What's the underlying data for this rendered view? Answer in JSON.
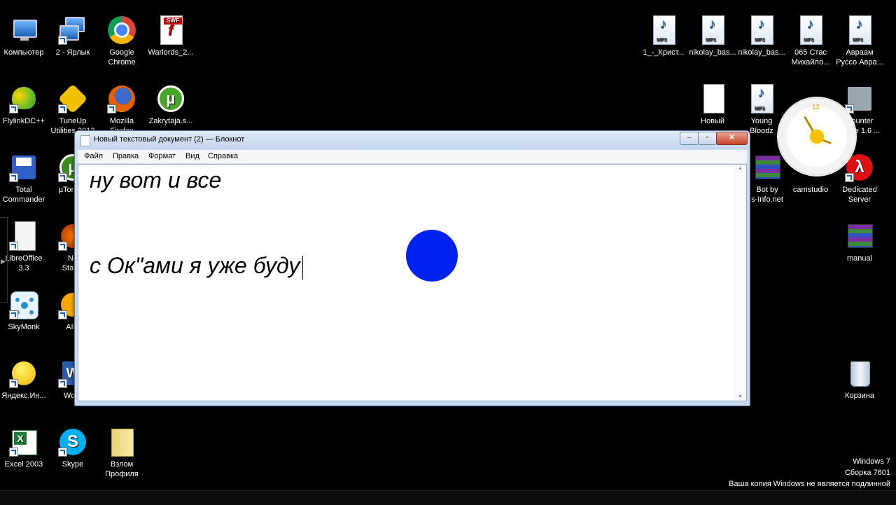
{
  "desktop": {
    "icons": [
      {
        "label": "Компьютер",
        "icon": "computer-icon"
      },
      {
        "label": "2 - Ярлык",
        "icon": "network-computer-icon"
      },
      {
        "label": "Google\nChrome",
        "icon": "chrome-icon"
      },
      {
        "label": "Warlords_2...",
        "icon": "swf-file-icon"
      },
      {
        "label": "FlylinkDC++",
        "icon": "flylink-icon"
      },
      {
        "label": "TuneUp\nUtilities 2013",
        "icon": "tuneup-icon"
      },
      {
        "label": "Mozilla\nFirefox",
        "icon": "firefox-icon"
      },
      {
        "label": "Zakrytaja.s...",
        "icon": "utorrent-icon"
      },
      {
        "label": "Total\nCommander",
        "icon": "total-commander-icon"
      },
      {
        "label": "µTorrent",
        "icon": "utorrent-icon"
      },
      {
        "label": "LibreOffice\n3.3",
        "icon": "libreoffice-icon"
      },
      {
        "label": "Ne\nStartS",
        "icon": "app-icon"
      },
      {
        "label": "SkyMonk",
        "icon": "skymonk-icon"
      },
      {
        "label": "AIM",
        "icon": "aim-icon"
      },
      {
        "label": "Яндекс.Ин...",
        "icon": "yandex-icon"
      },
      {
        "label": "Word",
        "icon": "word-icon"
      },
      {
        "label": "Excel 2003",
        "icon": "excel-icon"
      },
      {
        "label": "Skype",
        "icon": "skype-icon"
      },
      {
        "label": "Взлом\nПрофиля",
        "icon": "folder-icon"
      },
      {
        "label": "1_-_Крист...",
        "icon": "mp3-icon"
      },
      {
        "label": "nikolay_bas...",
        "icon": "mp3-icon"
      },
      {
        "label": "nikolay_bas...",
        "icon": "mp3-icon"
      },
      {
        "label": "065 Стас\nМихайло...",
        "icon": "mp3-icon"
      },
      {
        "label": "Авраам\nРуссо Авра...",
        "icon": "mp3-icon"
      },
      {
        "label": "Новый",
        "icon": "text-file-icon"
      },
      {
        "label": "Young\nBloodz",
        "icon": "mp3-icon"
      },
      {
        "label": "Counter\nStrike 1.6 ...",
        "icon": "counter-strike-icon"
      },
      {
        "label": "Bot by\ns-Info.net",
        "icon": "winrar-icon"
      },
      {
        "label": "camstudio",
        "icon": "camstudio-icon"
      },
      {
        "label": "Dedicated\nServer",
        "icon": "half-life-icon"
      },
      {
        "label": "manual",
        "icon": "winrar-icon"
      },
      {
        "label": "Корзина",
        "icon": "recycle-bin-icon"
      }
    ]
  },
  "notepad": {
    "title": "Новый текстовый документ (2) — Блокнот",
    "menu": [
      "Файл",
      "Правка",
      "Формат",
      "Вид",
      "Справка"
    ],
    "lines": [
      "ну вот и все",
      "с Ок\"ами я уже буду"
    ],
    "close_glyph": "✕",
    "max_glyph": "▫",
    "min_glyph": "–"
  },
  "watermark": {
    "line1": "Windows 7",
    "line2": "Сборка 7601",
    "line3": "Ваша копия Windows не является подлинной"
  },
  "colors": {
    "cursor_dot": "#0022f0",
    "desktop": "#000000"
  }
}
